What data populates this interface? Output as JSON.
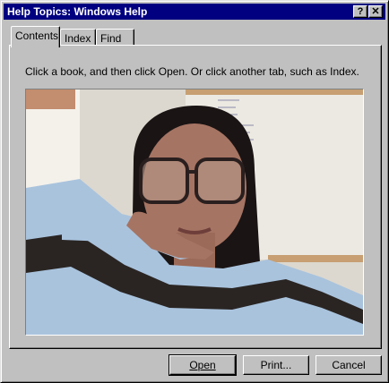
{
  "window": {
    "title": "Help Topics: Windows Help",
    "help_btn": "?",
    "close_btn": "✕"
  },
  "tabs": [
    {
      "label": "Contents",
      "active": true
    },
    {
      "label": "Index",
      "active": false
    },
    {
      "label": "Find",
      "active": false
    }
  ],
  "panel": {
    "instructions": "Click a book, and then click Open. Or click another tab, such as Index."
  },
  "photo": {
    "subject": "person with large glasses, dark long hair, hand under chin, light blue and black striped sweater",
    "colors": {
      "wall": "#dcd8cf",
      "window_light": "#f4f1ea",
      "hair": "#1a1414",
      "skin": "#a67463",
      "sweater_blue": "#a9c3dd",
      "sweater_black": "#2a2523",
      "board": "#ece9e2",
      "frame": "#c79f72"
    }
  },
  "buttons": {
    "open_label": "Open",
    "print_label": "Print...",
    "cancel_label": "Cancel"
  }
}
